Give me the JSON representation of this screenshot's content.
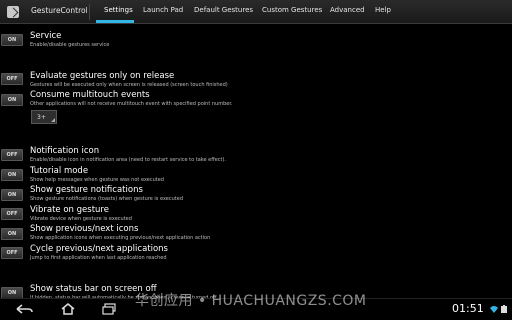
{
  "app": {
    "title": "GestureControl"
  },
  "tabs": [
    {
      "label": "Settings"
    },
    {
      "label": "Launch Pad"
    },
    {
      "label": "Default Gestures"
    },
    {
      "label": "Custom Gestures"
    },
    {
      "label": "Advanced"
    },
    {
      "label": "Help"
    }
  ],
  "settings": [
    {
      "state": "ON",
      "title": "Service",
      "subtitle": "Enable/disable gestures service"
    },
    {
      "state": "OFF",
      "title": "Evaluate gestures only on release",
      "subtitle": "Gestures will be executed only when screen is released (screen touch finished)"
    },
    {
      "state": "ON",
      "title": "Consume multitouch events",
      "subtitle": "Other applications will not receive multitouch event with specified point number."
    },
    {
      "state": "OFF",
      "title": "Notification icon",
      "subtitle": "Enable/disable icon in notification area (need to restart service to take effect)."
    },
    {
      "state": "ON",
      "title": "Tutorial mode",
      "subtitle": "Show help messages when gesture was not executed"
    },
    {
      "state": "ON",
      "title": "Show gesture notifications",
      "subtitle": "Show gesture notifications (toasts) when gesture is executed"
    },
    {
      "state": "OFF",
      "title": "Vibrate on gesture",
      "subtitle": "Vibrate device when gesture is executed"
    },
    {
      "state": "ON",
      "title": "Show previous/next icons",
      "subtitle": "Show application icons when executing previous/next application action"
    },
    {
      "state": "OFF",
      "title": "Cycle previous/next applications",
      "subtitle": "Jump to first application when last application reached"
    },
    {
      "state": "ON",
      "title": "Show status bar on screen off",
      "subtitle": "If hidden, status bar will automatically be shown when screen is turned off"
    }
  ],
  "multitouch_points": {
    "value": "3+"
  },
  "watermark": "华创应用 • HUACHUANGZS.COM",
  "system": {
    "clock": "01:51"
  },
  "colors": {
    "accent": "#33b5e5",
    "background": "#000000"
  },
  "icons": [
    "back-icon",
    "home-icon",
    "recent-apps-icon",
    "wifi-icon",
    "battery-icon",
    "gesture-control-app-icon"
  ]
}
